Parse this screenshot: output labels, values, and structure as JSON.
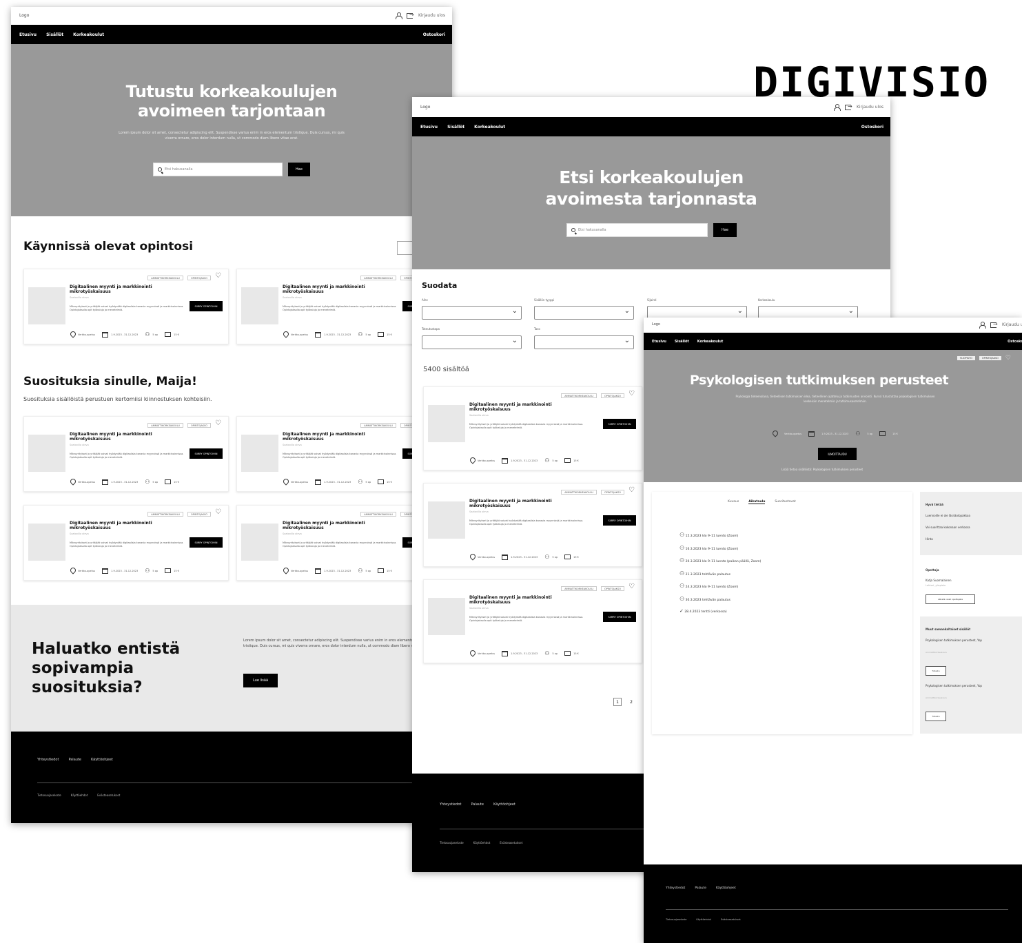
{
  "brand": {
    "name": "DIGIVISIO"
  },
  "common": {
    "logo": "Logo",
    "login": "Kirjaudu ulos",
    "nav": [
      "Etusivu",
      "Sisällöt",
      "Korkeakoulut"
    ],
    "nav_right": "Ostoskori",
    "search_placeholder": "Etsi hakusanalla",
    "search_button": "Hae",
    "footer_links": [
      "Yhteystiedot",
      "Palaute",
      "Käyttöohjeet"
    ],
    "footer_legal": [
      "Tietosuojaseloste",
      "Käyttöehdot",
      "Evästeasetukset"
    ]
  },
  "card": {
    "tag1": "AMMATTIKORKEAKOULU",
    "tag2": "OPINTOJAKSO",
    "title": "Digitaalinen myynti ja markkinointi mikrotyöskaisuus",
    "subtitle": "Saatavilla oleva",
    "desc": "Mikroyritykset ja yrittäjät voivat hyödyntää digitaalisia kanavia myynnissä ja markkinoinnissa. Opintojaksolla opit työkaluja ja menetelmiä.",
    "button": "SIIRRY OPINTOIHIN",
    "location": "Verkko-opetus",
    "dates": "1.9.2023 - 31.12.2023",
    "credits": "5 op",
    "price": "15 €"
  },
  "page1": {
    "hero_title_1": "Tutustu korkeakoulujen",
    "hero_title_2": "avoimeen tarjontaan",
    "hero_lede": "Lorem ipsum dolor sit amet, consectetur adipiscing elit. Suspendisse varius enim in eros elementum tristique. Duis cursus, mi quis viverra ornare, eros dolor interdum nulla, ut commodo diam libero vitae erat.",
    "section1": "Käynnissä olevat opintosi",
    "section2": "Suosituksia sinulle, Maija!",
    "section2_sub": "Suosituksia sisällöistä perustuen kertomiisi kiinnostuksen kohteisiin.",
    "cta_title": "Haluatko entistä sopivampia suosituksia?",
    "cta_text": "Lorem ipsum dolor sit amet, consectetur adipiscing elit. Suspendisse varius enim in eros elementum tristique. Duis cursus, mi quis viverra ornare, eros dolor interdum nulla, ut commodo diam libero vitae erat.",
    "cta_button": "Lue lisää"
  },
  "page2": {
    "hero_title_1": "Etsi korkeakoulujen",
    "hero_title_2": "avoimesta tarjonnasta",
    "filter_heading": "Suodata",
    "filters": [
      "Aihe",
      "Sisällön tyyppi",
      "Sijainti",
      "Korkeakoulu",
      "Toteutustapa",
      "Taso"
    ],
    "result_count": "5400 sisältöä",
    "pages": [
      "1",
      "2"
    ]
  },
  "page3": {
    "title": "Psykologisen tutkimuksen perusteet",
    "tags": [
      "YLIOPISTO",
      "OPINTOJAKSO"
    ],
    "lede": "Psykologia tieteenalana, tieteellisen tutkimuksen idea, tieteellinen ajattelu ja tutkimusten arviointi. Kurssi tutustuttaa psykologisen tutkimuksen keskeisiin menetelmiin ja tutkimusasetelmiin.",
    "button": "ILMOITTAUDU",
    "more_info": "Lisää tietoa sisällöstä: Psykologisen tutkimuksen perusteet",
    "tabs": [
      "Kuvaus",
      "Aikataulu",
      "Suoritustavat"
    ],
    "schedule": [
      "15.3.2023 klo 9–11 luento (Zoom)",
      "16.3.2023 klo 9–11 luento (Zoom)",
      "20.3.2023 klo 9–11 luento (paikan päällä, Zoom)",
      "21.3.2023 tehtävän palautus",
      "24.3.2023 klo 9–11 luento (Zoom)",
      "30.3.2023 tehtävän palautus",
      "28.4.2023 tentti (verkossa)"
    ],
    "side1_title": "Hyvä tietää",
    "side1_lines": [
      "Luennoille ei ole läsnäolopakkoa",
      "Voi suorittaa kokonaan verkossa",
      "Hinta"
    ],
    "side2_title": "Opettaja",
    "side2_name": "Katja Suomalainen",
    "side2_role": "Lehtori, yliopisto",
    "side2_button": "Lähetä viesti opettajalle",
    "side3_title": "Muut samankaltaiset sisällöt",
    "related": [
      {
        "title": "Psykologisen tutkimuksen perusteet, Yop",
        "meta": "Ammattikorkeakoulu",
        "button": "Tutustu"
      },
      {
        "title": "Psykologisen tutkimuksen perusteet, Yop",
        "meta": "Ammattikorkeakoulu",
        "button": "Tutustu"
      }
    ]
  }
}
